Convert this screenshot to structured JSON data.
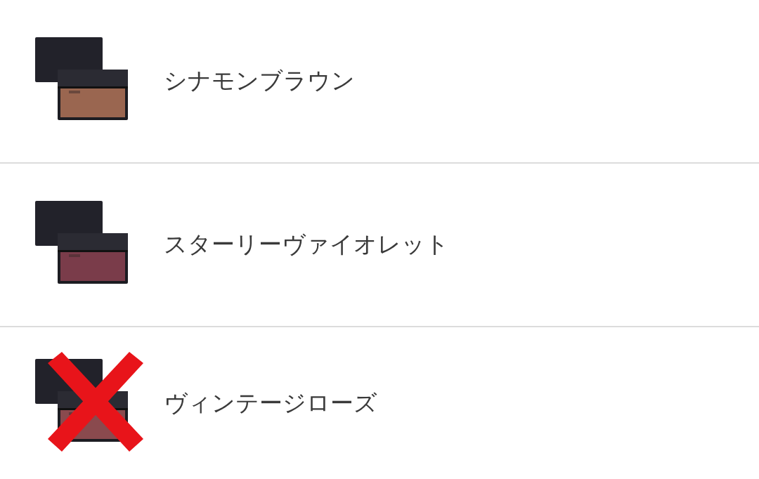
{
  "items": [
    {
      "name": "シナモンブラウン",
      "crossed_out": false
    },
    {
      "name": "スターリーヴァイオレット",
      "crossed_out": false
    },
    {
      "name": "ヴィンテージローズ",
      "crossed_out": true
    }
  ]
}
